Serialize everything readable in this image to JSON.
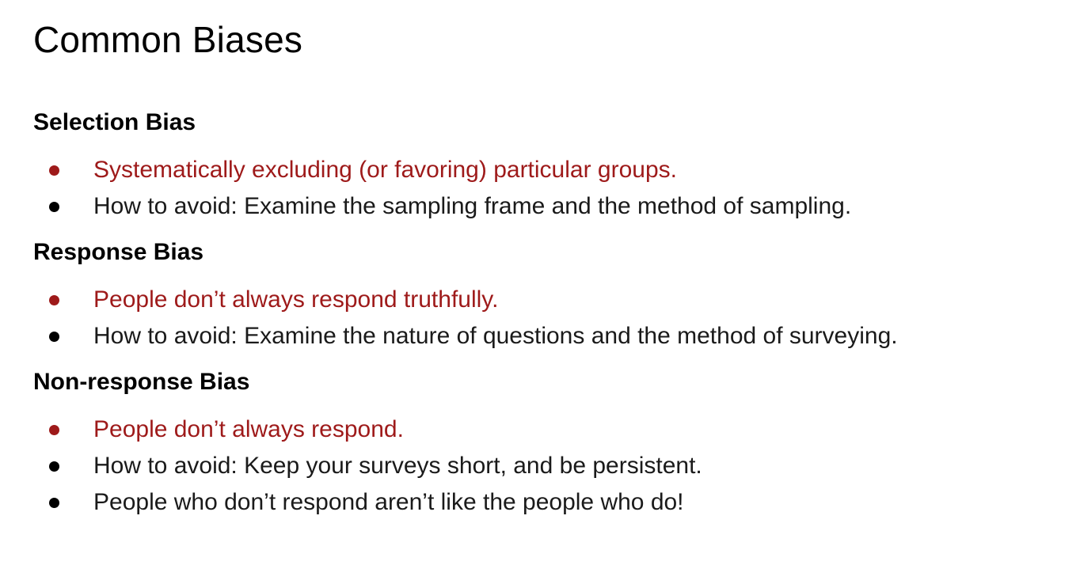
{
  "slide": {
    "title": "Common Biases",
    "colors": {
      "accent": "#9e1a1a",
      "text": "#000000",
      "background": "#ffffff"
    },
    "sections": [
      {
        "heading": "Selection Bias",
        "bullets": [
          {
            "text": "Systematically excluding (or favoring) particular groups.",
            "style": "accent"
          },
          {
            "text": "How to avoid: Examine the sampling frame and the method of sampling.",
            "style": "plain"
          }
        ]
      },
      {
        "heading": "Response Bias",
        "bullets": [
          {
            "text": "People don’t always respond truthfully.",
            "style": "accent"
          },
          {
            "text": "How to avoid: Examine the nature of questions and the method of surveying.",
            "style": "plain"
          }
        ]
      },
      {
        "heading": "Non-response Bias",
        "bullets": [
          {
            "text": "People don’t always respond.",
            "style": "accent"
          },
          {
            "text": "How to avoid: Keep your surveys short, and be persistent.",
            "style": "plain"
          },
          {
            "text": "People who don’t respond aren’t like the people who do!",
            "style": "plain"
          }
        ]
      }
    ]
  }
}
